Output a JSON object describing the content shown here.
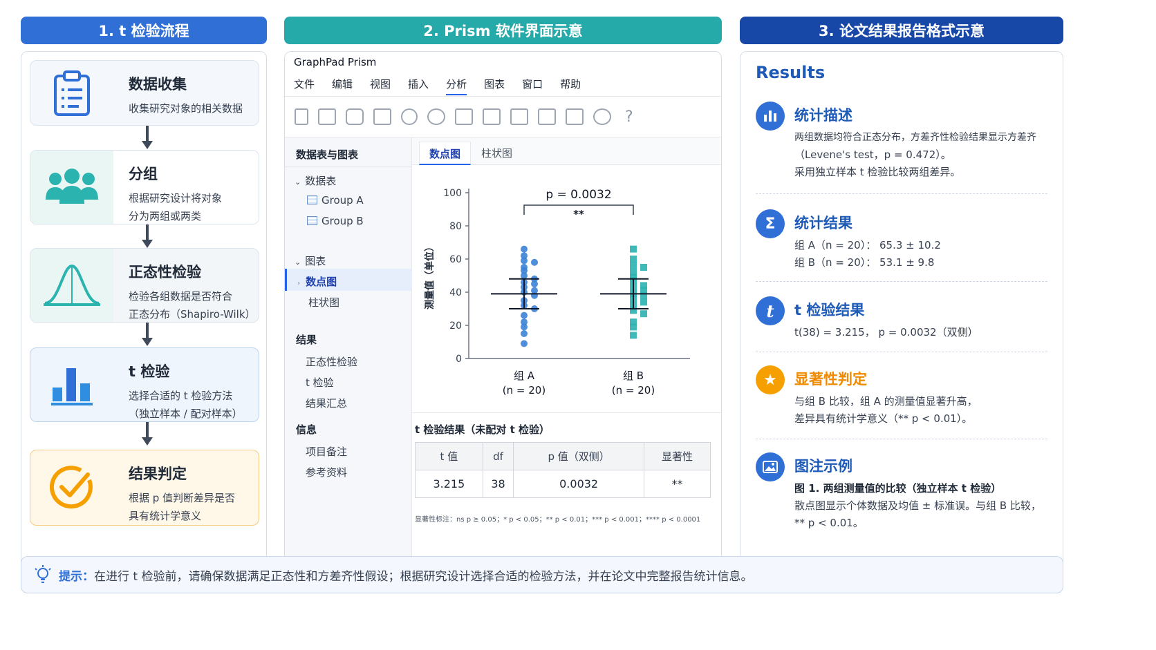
{
  "headers": {
    "col1": "1. t 检验流程",
    "col2": "2. Prism 软件界面示意",
    "col3": "3. 论文结果报告格式示意"
  },
  "colors": {
    "col1": "#2f6fd6",
    "col2": "#25a9a9",
    "col3": "#1748a8",
    "accent": "#2563eb",
    "orange": "#f59e0b"
  },
  "workflow": [
    {
      "title": "数据收集",
      "desc": [
        "收集研究对象的相关数据"
      ],
      "icon": "clipboard-icon"
    },
    {
      "title": "分组",
      "desc": [
        "根据研究设计将对象",
        "分为两组或两类"
      ],
      "icon": "group-icon"
    },
    {
      "title": "正态性检验",
      "desc": [
        "检验各组数据是否符合",
        "正态分布（Shapiro-Wilk）"
      ],
      "icon": "bell-curve-icon"
    },
    {
      "title": "t 检验",
      "desc": [
        "选择合适的 t 检验方法",
        "（独立样本 / 配对样本）"
      ],
      "icon": "bar-chart-icon"
    },
    {
      "title": "结果判定",
      "desc": [
        "根据 p 值判断差异是否",
        "具有统计学意义"
      ],
      "icon": "check-circle-icon"
    }
  ],
  "prism": {
    "app_title": "GraphPad Prism",
    "menu": [
      "文件",
      "编辑",
      "视图",
      "插入",
      "分析",
      "图表",
      "窗口",
      "帮助"
    ],
    "active_menu": "分析",
    "sidebar": {
      "header": "数据表与图表",
      "data_tables_label": "数据表",
      "tables": [
        "Group A",
        "Group B"
      ],
      "graphs_label": "图表",
      "graphs": [
        "数点图",
        "柱状图"
      ],
      "results_label": "结果",
      "results": [
        "正态性检验",
        "t 检验",
        "结果汇总"
      ],
      "info_label": "信息",
      "info": [
        "项目备注",
        "参考资料"
      ]
    },
    "tabs": [
      "数点图",
      "柱状图"
    ],
    "active_tab": "数点图",
    "table_title": "t 检验结果（未配对 t 检验）",
    "table_headers": [
      "t 值",
      "df",
      "p 值（双侧）",
      "显著性"
    ],
    "table_row": [
      "3.215",
      "38",
      "0.0032",
      "**"
    ],
    "footnote": "显著性标注：ns p ≥ 0.05；* p < 0.05；** p < 0.01；*** p < 0.001；**** p < 0.0001"
  },
  "chart_data": {
    "type": "scatter",
    "ylabel": "测量值（单位）",
    "ylim": [
      0,
      100
    ],
    "yticks": [
      0,
      20,
      40,
      60,
      80,
      100
    ],
    "categories": [
      "组 A",
      "组 B"
    ],
    "category_n": [
      "(n = 20)",
      "(n = 20)"
    ],
    "annotation": "p = 0.0032",
    "significance": "**",
    "series": [
      {
        "name": "组 A",
        "mean": 39,
        "sd_low": 30,
        "sd_high": 48,
        "color": "#3b82d6",
        "values": [
          66,
          62,
          59,
          58,
          55,
          53,
          50,
          48,
          46,
          45,
          43,
          41,
          40,
          38,
          35,
          32,
          30,
          26,
          22,
          19,
          15,
          9
        ]
      },
      {
        "name": "组 B",
        "mean": 39,
        "sd_low": 30,
        "sd_high": 48,
        "color": "#2bb3b0",
        "values": [
          66,
          60,
          56,
          55,
          52,
          49,
          47,
          44,
          43,
          41,
          39,
          38,
          36,
          34,
          32,
          29,
          27,
          22,
          19,
          14
        ]
      }
    ]
  },
  "results": {
    "heading": "Results",
    "sections": [
      {
        "title": "统计描述",
        "icon": "bar-chart-icon",
        "lines": [
          "两组数据均符合正态分布，方差齐性检验结果显示方差齐",
          "（Levene's test，p = 0.472）。",
          "采用独立样本 t 检验比较两组差异。"
        ]
      },
      {
        "title": "统计结果",
        "icon": "sigma-icon",
        "lines": [
          "组 A（n = 20）：  65.3 ± 10.2",
          "组 B（n = 20）：  53.1 ± 9.8"
        ]
      },
      {
        "title": "t 检验结果",
        "icon": "t-icon",
        "lines": [
          "t(38) = 3.215，  p = 0.0032（双侧）"
        ]
      },
      {
        "title": "显著性判定",
        "icon": "star-icon",
        "lines": [
          "与组 B 比较，组 A 的测量值显著升高，",
          "差异具有统计学意义（** p < 0.01）。"
        ]
      },
      {
        "title": "图注示例",
        "icon": "image-icon",
        "lines": [
          "图 1. 两组测量值的比较（独立样本 t 检验）",
          "散点图显示个体数据及均值 ± 标准误。与组 B 比较，",
          "** p < 0.01。"
        ]
      }
    ]
  },
  "tip": {
    "label": "提示：",
    "text": "在进行 t 检验前，请确保数据满足正态性和方差齐性假设；根据研究设计选择合适的检验方法，并在论文中完整报告统计信息。"
  }
}
